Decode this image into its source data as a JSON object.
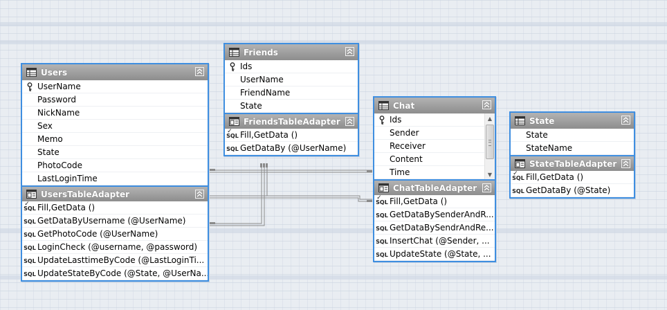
{
  "entities": {
    "users": {
      "title": "Users",
      "fields": [
        "UserName",
        "Password",
        "NickName",
        "Sex",
        "Memo",
        "State",
        "PhotoCode",
        "LastLoginTime"
      ],
      "adapter": {
        "title": "UsersTableAdapter",
        "methods": [
          "Fill,GetData ()",
          "GetDataByUsername (@UserName)",
          "GetPhotoCode (@UserName)",
          "LoginCheck (@username, @password)",
          "UpdateLasttimeByCode (@LastLoginTi...",
          "UpdateStateByCode (@State, @UserNa..."
        ]
      }
    },
    "friends": {
      "title": "Friends",
      "fields": [
        "Ids",
        "UserName",
        "FriendName",
        "State"
      ],
      "adapter": {
        "title": "FriendsTableAdapter",
        "methods": [
          "Fill,GetData ()",
          "GetDataBy (@UserName)"
        ]
      }
    },
    "chat": {
      "title": "Chat",
      "fields": [
        "Ids",
        "Sender",
        "Receiver",
        "Content",
        "Time"
      ],
      "adapter": {
        "title": "ChatTableAdapter",
        "methods": [
          "Fill,GetData ()",
          "GetDataBySenderAndR...",
          "GetDataBySendrAndRe...",
          "InsertChat (@Sender, ...",
          "UpdateState (@State, ..."
        ]
      }
    },
    "state": {
      "title": "State",
      "fields": [
        "State",
        "StateName"
      ],
      "adapter": {
        "title": "StateTableAdapter",
        "methods": [
          "Fill,GetData ()",
          "GetDataBy (@State)"
        ]
      }
    }
  },
  "icons": {
    "table": "table-icon",
    "adapter": "table-adapter-icon",
    "key": "primary-key-icon",
    "sql": "sql-query-icon",
    "collapse": "collapse-icon"
  },
  "sql_label": "SQL",
  "colors": {
    "accent": "#3e8ee0",
    "header": "#9b9b9b",
    "canvas": "#e9edf2",
    "connector": "#8a8a8a"
  }
}
